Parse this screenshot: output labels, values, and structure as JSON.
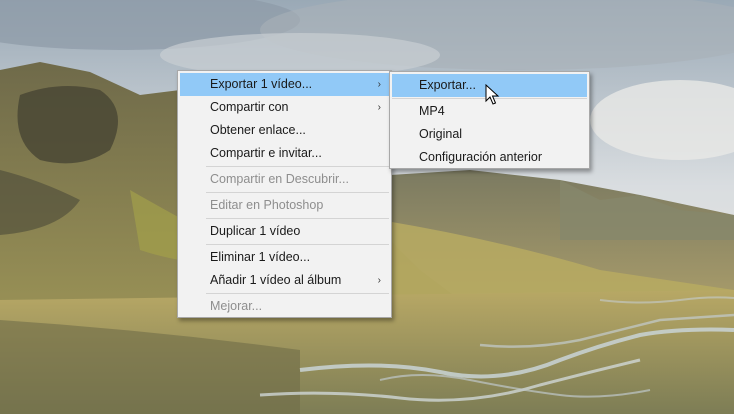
{
  "main_menu": {
    "items": [
      {
        "label": "Exportar 1 vídeo...",
        "submenu": true
      },
      {
        "label": "Compartir con",
        "submenu": true
      },
      {
        "label": "Obtener enlace..."
      },
      {
        "label": "Compartir e invitar..."
      },
      {
        "label": "Compartir en Descubrir...",
        "disabled": true
      },
      {
        "label": "Editar en Photoshop",
        "disabled": true
      },
      {
        "label": "Duplicar 1 vídeo"
      },
      {
        "label": "Eliminar 1 vídeo..."
      },
      {
        "label": "Añadir 1 vídeo al álbum",
        "submenu": true
      },
      {
        "label": "Mejorar...",
        "disabled": true
      }
    ],
    "submenu_arrow": "›"
  },
  "export_submenu": {
    "items": [
      {
        "label": "Exportar..."
      },
      {
        "label": "MP4"
      },
      {
        "label": "Original"
      },
      {
        "label": "Configuración anterior"
      }
    ]
  },
  "colors": {
    "highlight": "#91c9f7",
    "menu_bg": "#f2f2f2",
    "disabled_text": "#8e8e8e"
  },
  "icons": {
    "cursor": "arrow-pointer-icon",
    "submenu": "chevron-right-icon"
  }
}
